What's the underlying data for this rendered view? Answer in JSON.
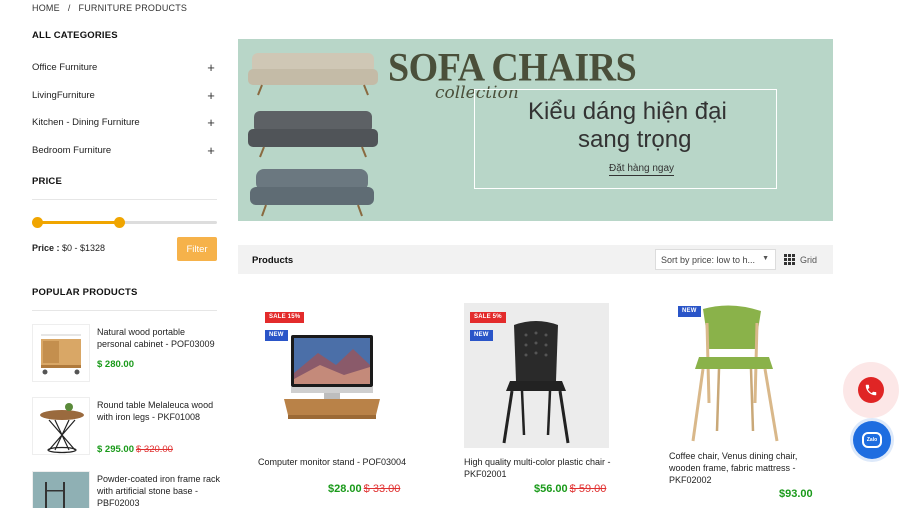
{
  "breadcrumb": {
    "home": "HOME",
    "separator": "/",
    "current": "FURNITURE PRODUCTS"
  },
  "sidebar": {
    "categories_title": "ALL CATEGORIES",
    "categories": [
      {
        "label": "Office Furniture",
        "expand": "+"
      },
      {
        "label": "LivingFurniture",
        "expand": "+"
      },
      {
        "label": "Kitchen - Dining Furniture",
        "expand": "+"
      },
      {
        "label": "Bedroom Furniture",
        "expand": "+"
      }
    ],
    "price_title": "PRICE",
    "price_label": "Price :",
    "price_range": "$0 - $1328",
    "slider_min_fraction": 0.0,
    "slider_max_fraction": 0.47,
    "filter_label": "Filter",
    "popular_title": "POPULAR PRODUCTS",
    "popular": [
      {
        "name": "Natural wood portable personal cabinet - POF03009",
        "price": "$ 280.00",
        "old_price": ""
      },
      {
        "name": "Round table Melaleuca wood with iron legs - PKF01008",
        "price": "$ 295.00",
        "old_price": "$ 320.00"
      },
      {
        "name": "Powder-coated iron frame rack with artificial stone base - PBF02003",
        "price": "",
        "old_price": ""
      }
    ]
  },
  "banner": {
    "title": "SOFA CHAIRS",
    "script": "collection",
    "line1": "Kiểu dáng hiện đại",
    "line2": "sang trọng",
    "cta": "Đặt hàng ngay",
    "bg_color": "#b8d6c8"
  },
  "toolbar": {
    "products_label": "Products",
    "sort_value": "Sort by price: low to h...",
    "sort_caret": "▼",
    "view_label": "Grid"
  },
  "products": [
    {
      "sale": "SALE 15%",
      "new": "NEW",
      "name": "Computer monitor stand - POF03004",
      "price": "$28.00",
      "old_price": "$ 33.00"
    },
    {
      "sale": "SALE 5%",
      "new": "NEW",
      "name": "High quality multi-color plastic chair - PKF02001",
      "price": "$56.00",
      "old_price": "$ 59.00"
    },
    {
      "sale": "",
      "new": "NEW",
      "name": "Coffee chair, Venus dining chair, wooden frame, fabric mattress - PKF02002",
      "price": "$93.00",
      "old_price": ""
    }
  ],
  "floating": {
    "zalo_label": "Zalo"
  },
  "colors": {
    "accent": "#f0a500",
    "price_green": "#1a9a1a",
    "old_price_red": "#e03030",
    "badge_sale": "#e32b2b",
    "badge_new": "#2a55c8"
  },
  "icons": {
    "expand": "plus-icon",
    "grid": "grid-icon",
    "phone": "phone-icon",
    "chat": "zalo-chat-icon"
  }
}
